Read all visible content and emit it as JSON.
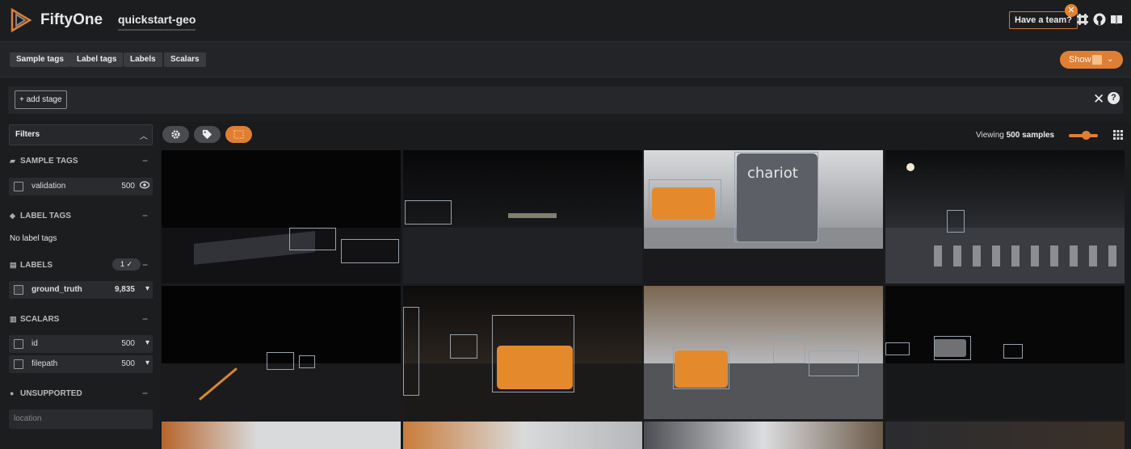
{
  "header": {
    "app_title": "FiftyOne",
    "dataset_name": "quickstart-geo",
    "team_button": "Have a team?",
    "team_close": "✕",
    "icons": [
      "slack-icon",
      "github-icon",
      "docs-icon"
    ]
  },
  "tagbar": {
    "buttons": [
      "Sample tags",
      "Label tags",
      "Labels",
      "Scalars"
    ],
    "show_label": "Show"
  },
  "stagebar": {
    "add_stage": "+ add stage",
    "clear": "✕",
    "help": "?"
  },
  "sidebar": {
    "filters_label": "Filters",
    "sample_tags": {
      "title": "SAMPLE TAGS",
      "items": [
        {
          "name": "validation",
          "count": "500"
        }
      ]
    },
    "label_tags": {
      "title": "LABEL TAGS",
      "empty": "No label tags"
    },
    "labels": {
      "title": "LABELS",
      "active_count": "1 ✓",
      "items": [
        {
          "name": "ground_truth",
          "count": "9,835"
        }
      ]
    },
    "scalars": {
      "title": "SCALARS",
      "items": [
        {
          "name": "id",
          "count": "500"
        },
        {
          "name": "filepath",
          "count": "500"
        }
      ]
    },
    "unsupported": {
      "title": "UNSUPPORTED",
      "items": [
        "location"
      ]
    }
  },
  "grid": {
    "viewing_prefix": "Viewing ",
    "viewing_count": "500 samples",
    "zoom_level": 0.55,
    "accent": "#e07f32"
  }
}
